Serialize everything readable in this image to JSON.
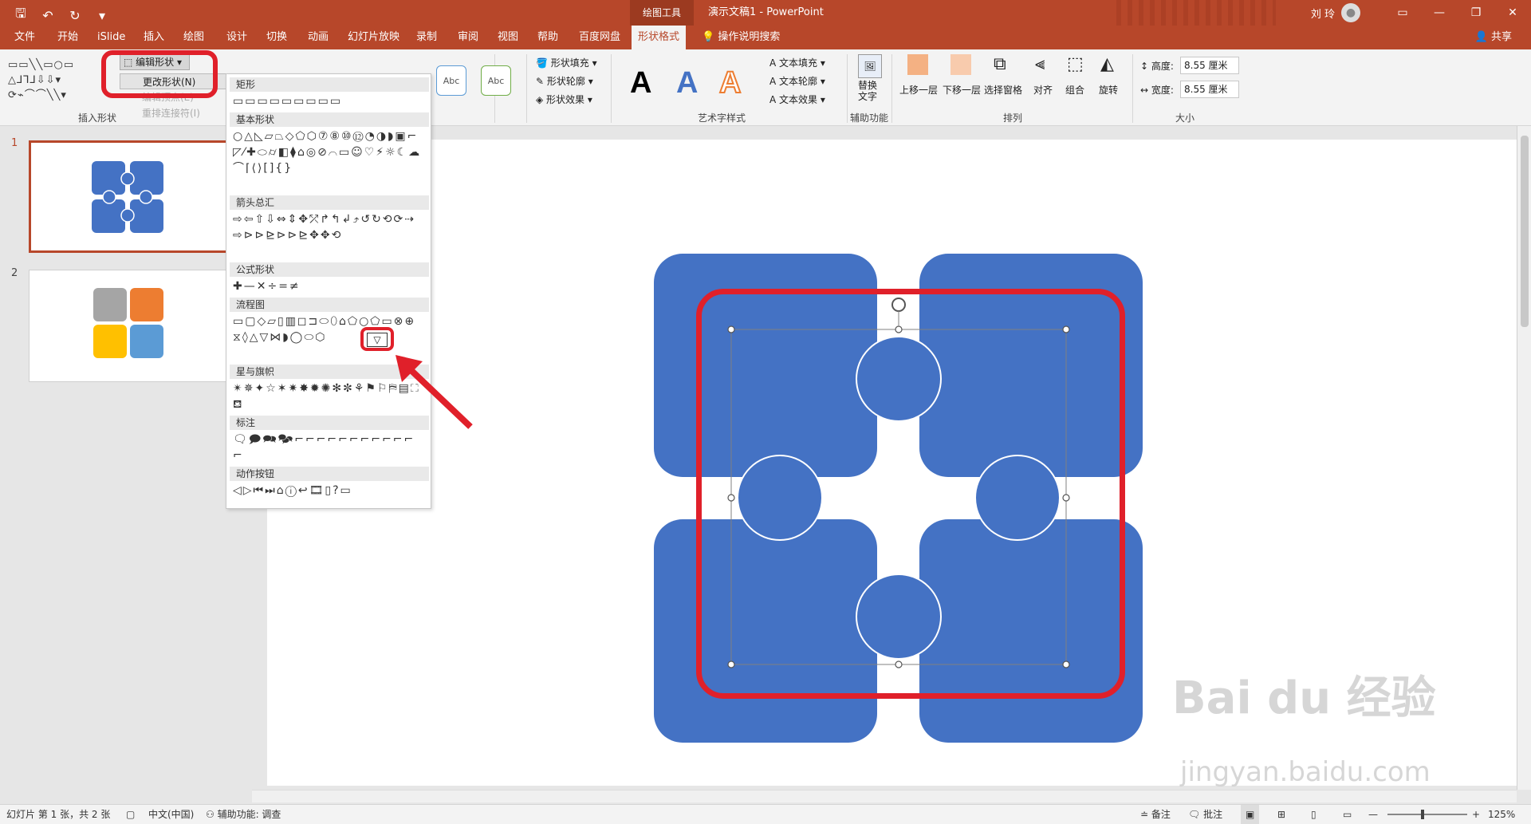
{
  "titlebar": {
    "context_tab": "绘图工具",
    "doc_title": "演示文稿1  -  PowerPoint",
    "user": "刘 玲",
    "quick_access": [
      "save-icon",
      "undo-icon",
      "redo-icon",
      "customize-icon"
    ]
  },
  "tabs": [
    "文件",
    "开始",
    "iSlide",
    "插入",
    "绘图",
    "设计",
    "切换",
    "动画",
    "幻灯片放映",
    "录制",
    "审阅",
    "视图",
    "帮助",
    "百度网盘",
    "形状格式"
  ],
  "tell_me": "操作说明搜索",
  "share": "共享",
  "ribbon": {
    "insert_shapes_label": "插入形状",
    "edit_shape_btn": "编辑形状",
    "edit_menu": [
      "更改形状(N)",
      "编辑顶点(E)",
      "重排连接符(I)"
    ],
    "style_labels": [
      "Abc",
      "Abc"
    ],
    "shape_fill": "形状填充",
    "shape_outline": "形状轮廓",
    "shape_effects": "形状效果",
    "text_fill": "文本填充",
    "text_outline": "文本轮廓",
    "text_effects": "文本效果",
    "wordart_label": "艺术字样式",
    "wordart_letter": "A",
    "alt_text": "替换\n文字",
    "accessibility_label": "辅助功能",
    "bring_forward": "上移一层",
    "send_backward": "下移一层",
    "selection_pane": "选择窗格",
    "align": "对齐",
    "group": "组合",
    "rotate": "旋转",
    "arrange_label": "排列",
    "height_label": "高度:",
    "height_value": "8.55 厘米",
    "width_label": "宽度:",
    "width_value": "8.55 厘米",
    "size_label": "大小"
  },
  "gallery": {
    "sections": [
      "矩形",
      "基本形状",
      "箭头总汇",
      "公式形状",
      "流程图",
      "星与旗帜",
      "标注",
      "动作按钮"
    ],
    "selected_shape": "flowchart-merge"
  },
  "slides": [
    {
      "number": "1"
    },
    {
      "number": "2"
    }
  ],
  "status": {
    "slide_info": "幻灯片 第 1 张，共 2 张",
    "language": "中文(中国)",
    "accessibility": "辅助功能: 调查",
    "notes": "备注",
    "comments": "批注",
    "zoom": "125%"
  },
  "colors": {
    "accent": "#b7472a",
    "shape_blue": "#4472c4",
    "highlight_red": "#e0202a",
    "thumb2_gray": "#a5a5a5",
    "thumb2_orange": "#ed7d31",
    "thumb2_yellow": "#ffc000",
    "thumb2_blue": "#5b9bd5"
  },
  "watermark": {
    "brand": "Bai du 经验",
    "url": "jingyan.baidu.com"
  }
}
